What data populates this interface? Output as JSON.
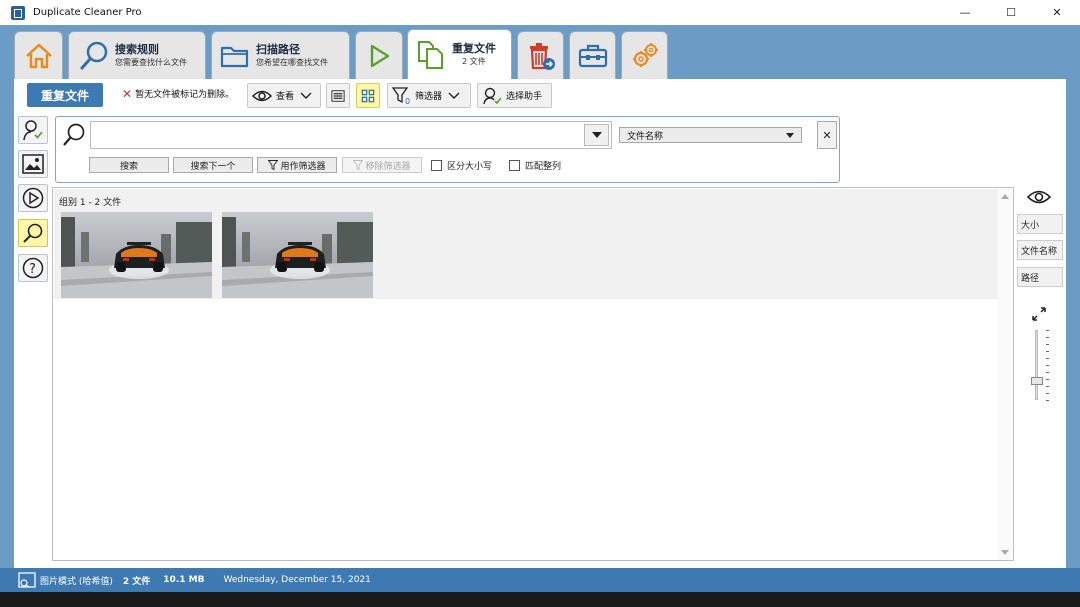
{
  "window": {
    "title": "Duplicate Cleaner Pro",
    "minimize": "—",
    "maximize": "☐",
    "close": "✕"
  },
  "tabs": [
    {
      "id": "home",
      "label": "",
      "sub": ""
    },
    {
      "id": "search-rules",
      "label": "搜索规则",
      "sub": "您需要查找什么文件"
    },
    {
      "id": "scan-path",
      "label": "扫描路径",
      "sub": "您希望在哪查找文件"
    },
    {
      "id": "scan",
      "label": "",
      "sub": ""
    },
    {
      "id": "duplicates",
      "label": "重复文件",
      "sub": "2 文件"
    },
    {
      "id": "removal",
      "label": "",
      "sub": ""
    },
    {
      "id": "tools",
      "label": "",
      "sub": ""
    },
    {
      "id": "settings",
      "label": "",
      "sub": ""
    }
  ],
  "toolbar": {
    "title": "重复文件",
    "status_msg": "暂无文件被标记为删除。",
    "view_label": "查看",
    "filter_label": "筛选器",
    "assistant_label": "选择助手"
  },
  "search": {
    "value": "",
    "placeholder": "",
    "field": "文件名称",
    "search_btn": "搜索",
    "next_btn": "搜索下一个",
    "use_filter_btn": "用作筛选器",
    "remove_filter_btn": "移除筛选器",
    "case_label": "区分大小写",
    "whole_label": "匹配整列"
  },
  "results": {
    "group_label": "组别 1  -  2 文件"
  },
  "right_panel": {
    "size_btn": "大小",
    "name_btn": "文件名称",
    "path_btn": "路径"
  },
  "status": {
    "mode": "图片模式 (哈希值)",
    "files": "2 文件",
    "size": "10.1 MB",
    "date": "Wednesday, December 15, 2021"
  },
  "colors": {
    "accent": "#3e79b2",
    "tabbar": "#6c9cc6",
    "highlight": "#fdf8a8"
  }
}
